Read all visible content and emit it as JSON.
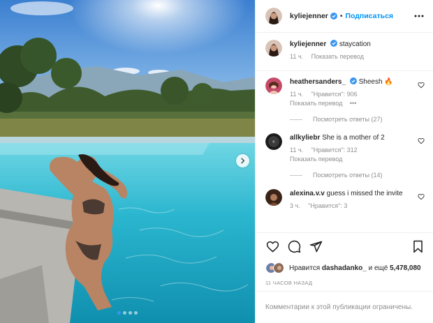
{
  "header": {
    "username": "kyliejenner",
    "separator": "•",
    "follow_label": "Подписаться"
  },
  "caption": {
    "username": "kyliejenner",
    "text": "staycation",
    "time": "11 ч.",
    "translate": "Показать перевод"
  },
  "comments": [
    {
      "username": "heathersanders_",
      "verified": true,
      "text": "Sheesh 🔥",
      "time": "11 ч.",
      "likes": "\"Нравится\": 906",
      "translate": "Показать перевод",
      "options": "•••",
      "view_replies": "Посмотреть ответы (27)"
    },
    {
      "username": "allkyliebr",
      "verified": false,
      "text": "She is a mother of 2",
      "time": "11 ч.",
      "likes": "\"Нравится\": 312",
      "translate": "Показать перевод",
      "view_replies": "Посмотреть ответы (14)"
    },
    {
      "username": "alexina.v.v",
      "verified": false,
      "text": "guess i missed the invite",
      "time": "3 ч.",
      "likes": "\"Нравится\": 3"
    }
  ],
  "likes": {
    "prefix": "Нравится",
    "user": "dashadanko_",
    "middle": "и ещё",
    "count": "5,478,080"
  },
  "timestamp": "11 ЧАСОВ НАЗАД",
  "comments_closed": "Комментарии к этой публикации ограничены.",
  "carousel": {
    "total": 4,
    "active_index": 0
  },
  "colors": {
    "accent": "#0095f6",
    "verified": "#3897f0",
    "muted": "#8e8e8e",
    "text": "#262626"
  }
}
